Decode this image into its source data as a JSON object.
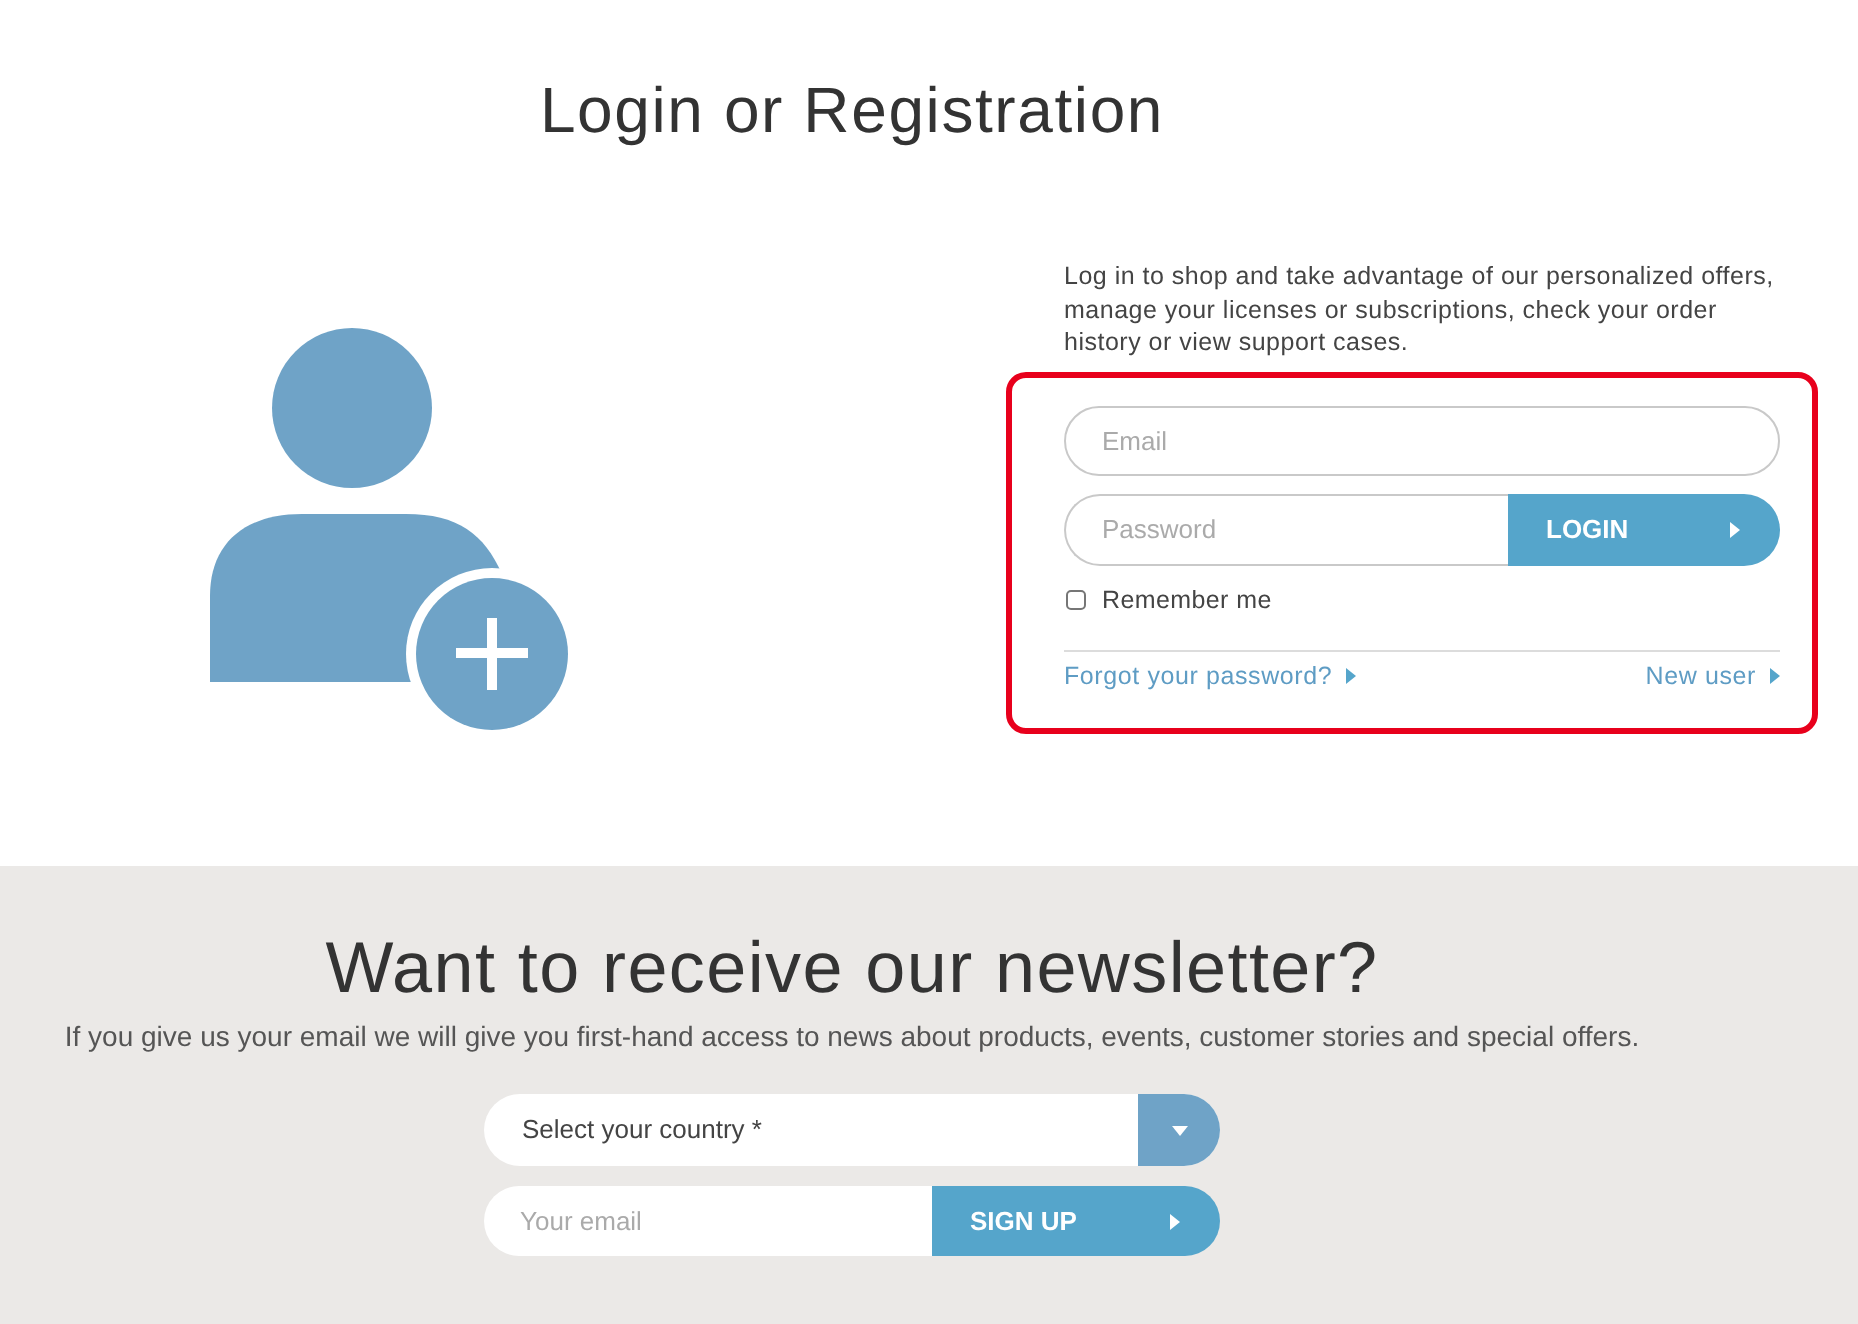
{
  "title": "Login or Registration",
  "login": {
    "intro": "Log in to shop and take advantage of our personalized offers, manage your licenses or subscriptions, check your order history or view support cases.",
    "email": {
      "placeholder": "Email"
    },
    "password": {
      "placeholder": "Password"
    },
    "login_button": "LOGIN",
    "remember_me": {
      "label": "Remember me",
      "checked": false
    },
    "links": [
      {
        "label": "Forgot your password?"
      },
      {
        "label": "New user"
      }
    ]
  },
  "newsletter": {
    "title": "Want to receive our newsletter?",
    "description": "If you give us your email we will give you first-hand access to news about products, events, customer stories and special offers.",
    "country_select": {
      "value": "Select your country *"
    },
    "email": {
      "placeholder": "Your email"
    },
    "signup_button": "SIGN UP"
  }
}
